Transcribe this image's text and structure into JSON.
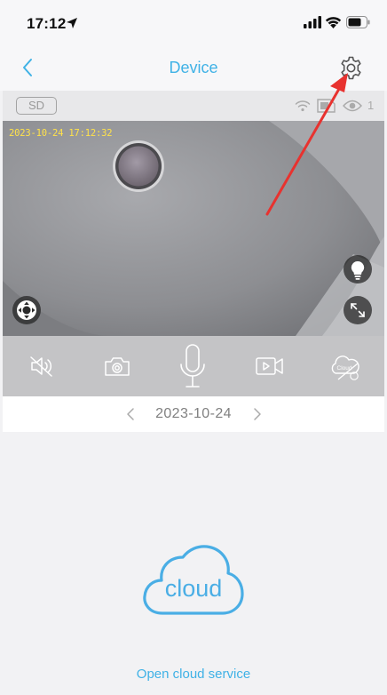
{
  "status_bar": {
    "time": "17:12",
    "icons": [
      "location-arrow-icon",
      "cellular-signal-icon",
      "wifi-icon",
      "battery-icon"
    ]
  },
  "nav": {
    "back_icon": "chevron-left-icon",
    "title": "Device",
    "settings_icon": "gear-icon"
  },
  "info_bar": {
    "quality_label": "SD",
    "viewer_count": "1",
    "icons": [
      "wifi-signal-icon",
      "sd-card-icon",
      "eye-icon"
    ]
  },
  "video": {
    "timestamp": "2023-10-24 17:12:32",
    "controls": [
      "ptz-joystick-icon",
      "lightbulb-icon",
      "fullscreen-icon"
    ]
  },
  "toolbar": {
    "items": [
      "mute-speaker-icon",
      "snapshot-camera-icon",
      "microphone-icon",
      "record-video-icon",
      "cloud-disabled-icon"
    ],
    "cloud_badge_text": "Cloud"
  },
  "date_bar": {
    "date": "2023-10-24"
  },
  "cloud_section": {
    "icon_text": "cloud",
    "link": "Open cloud service"
  },
  "colors": {
    "accent": "#40b2e6",
    "annotation_arrow": "#e8322f",
    "timestamp": "#ffe24a"
  }
}
